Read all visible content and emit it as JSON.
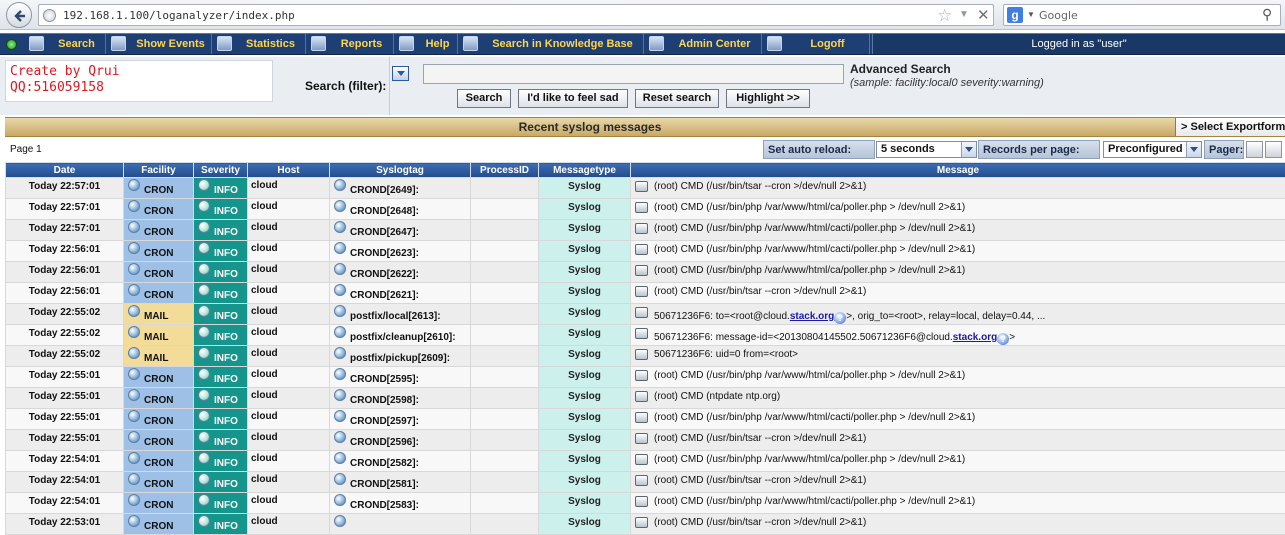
{
  "browser": {
    "url": "192.168.1.100/loganalyzer/index.php",
    "search_placeholder": "Google"
  },
  "menu": {
    "items": [
      {
        "label": "Search",
        "icon": "magnifier-icon"
      },
      {
        "label": "Show Events",
        "icon": "home-icon"
      },
      {
        "label": "Statistics",
        "icon": "chart-icon"
      },
      {
        "label": "Reports",
        "icon": "reports-icon"
      },
      {
        "label": "Help",
        "icon": "help-icon"
      },
      {
        "label": "Search in Knowledge Base",
        "icon": "knowledgebase-icon"
      },
      {
        "label": "Admin Center",
        "icon": "star-icon"
      },
      {
        "label": "Logoff",
        "icon": "logoff-icon"
      }
    ],
    "logged_in": "Logged in as \"user\""
  },
  "credit": {
    "line1": "Create by Qrui",
    "line2": "QQ:516059158"
  },
  "search": {
    "label": "Search (filter):",
    "value": "",
    "buttons": [
      "Search",
      "I'd like to feel sad",
      "Reset search",
      "Highlight >>"
    ],
    "advanced_title": "Advanced Search",
    "advanced_sample": "(sample: facility:local0 severity:warning)"
  },
  "table": {
    "title": "Recent syslog messages",
    "export_label": "> Select Exportformat",
    "page_label": "Page 1",
    "auto_reload_label": "Set auto reload:",
    "auto_reload_value": "5 seconds",
    "records_label": "Records per page:",
    "records_value": "Preconfigured (",
    "pager_label": "Pager:",
    "columns": [
      "Date",
      "Facility",
      "Severity",
      "Host",
      "Syslogtag",
      "ProcessID",
      "Messagetype",
      "Message"
    ],
    "rows": [
      {
        "date": "Today 22:57:01",
        "facility": "CRON",
        "severity": "INFO",
        "host": "cloud",
        "tag": "CROND[2649]:",
        "pid": "",
        "type": "Syslog",
        "message": "(root) CMD (/usr/bin/tsar --cron >/dev/null 2>&1)"
      },
      {
        "date": "Today 22:57:01",
        "facility": "CRON",
        "severity": "INFO",
        "host": "cloud",
        "tag": "CROND[2648]:",
        "pid": "",
        "type": "Syslog",
        "message": "(root) CMD (/usr/bin/php /var/www/html/ca/poller.php > /dev/null 2>&1)"
      },
      {
        "date": "Today 22:57:01",
        "facility": "CRON",
        "severity": "INFO",
        "host": "cloud",
        "tag": "CROND[2647]:",
        "pid": "",
        "type": "Syslog",
        "message": "(root) CMD (/usr/bin/php /var/www/html/cacti/poller.php > /dev/null 2>&1)"
      },
      {
        "date": "Today 22:56:01",
        "facility": "CRON",
        "severity": "INFO",
        "host": "cloud",
        "tag": "CROND[2623]:",
        "pid": "",
        "type": "Syslog",
        "message": "(root) CMD (/usr/bin/php /var/www/html/cacti/poller.php > /dev/null 2>&1)"
      },
      {
        "date": "Today 22:56:01",
        "facility": "CRON",
        "severity": "INFO",
        "host": "cloud",
        "tag": "CROND[2622]:",
        "pid": "",
        "type": "Syslog",
        "message": "(root) CMD (/usr/bin/php /var/www/html/ca/poller.php > /dev/null 2>&1)"
      },
      {
        "date": "Today 22:56:01",
        "facility": "CRON",
        "severity": "INFO",
        "host": "cloud",
        "tag": "CROND[2621]:",
        "pid": "",
        "type": "Syslog",
        "message": "(root) CMD (/usr/bin/tsar --cron >/dev/null 2>&1)"
      },
      {
        "date": "Today 22:55:02",
        "facility": "MAIL",
        "severity": "INFO",
        "host": "cloud",
        "tag": "postfix/local[2613]:",
        "pid": "",
        "type": "Syslog",
        "message_pre": "50671236F6: to=<root@cloud.",
        "message_link": "stack.org",
        "message_post": ">, orig_to=<root>, relay=local, delay=0.44, ..."
      },
      {
        "date": "Today 22:55:02",
        "facility": "MAIL",
        "severity": "INFO",
        "host": "cloud",
        "tag": "postfix/cleanup[2610]:",
        "pid": "",
        "type": "Syslog",
        "message_pre": "50671236F6: message-id=<20130804145502.50671236F6@cloud.",
        "message_link": "stack.org",
        "message_post": ">"
      },
      {
        "date": "Today 22:55:02",
        "facility": "MAIL",
        "severity": "INFO",
        "host": "cloud",
        "tag": "postfix/pickup[2609]:",
        "pid": "",
        "type": "Syslog",
        "message": "50671236F6: uid=0 from=<root>"
      },
      {
        "date": "Today 22:55:01",
        "facility": "CRON",
        "severity": "INFO",
        "host": "cloud",
        "tag": "CROND[2595]:",
        "pid": "",
        "type": "Syslog",
        "message": "(root) CMD (/usr/bin/php /var/www/html/ca/poller.php > /dev/null 2>&1)"
      },
      {
        "date": "Today 22:55:01",
        "facility": "CRON",
        "severity": "INFO",
        "host": "cloud",
        "tag": "CROND[2598]:",
        "pid": "",
        "type": "Syslog",
        "message": "(root) CMD (ntpdate ntp.org)"
      },
      {
        "date": "Today 22:55:01",
        "facility": "CRON",
        "severity": "INFO",
        "host": "cloud",
        "tag": "CROND[2597]:",
        "pid": "",
        "type": "Syslog",
        "message": "(root) CMD (/usr/bin/php /var/www/html/cacti/poller.php > /dev/null 2>&1)"
      },
      {
        "date": "Today 22:55:01",
        "facility": "CRON",
        "severity": "INFO",
        "host": "cloud",
        "tag": "CROND[2596]:",
        "pid": "",
        "type": "Syslog",
        "message": "(root) CMD (/usr/bin/tsar --cron >/dev/null 2>&1)"
      },
      {
        "date": "Today 22:54:01",
        "facility": "CRON",
        "severity": "INFO",
        "host": "cloud",
        "tag": "CROND[2582]:",
        "pid": "",
        "type": "Syslog",
        "message": "(root) CMD (/usr/bin/php /var/www/html/ca/poller.php > /dev/null 2>&1)"
      },
      {
        "date": "Today 22:54:01",
        "facility": "CRON",
        "severity": "INFO",
        "host": "cloud",
        "tag": "CROND[2581]:",
        "pid": "",
        "type": "Syslog",
        "message": "(root) CMD (/usr/bin/tsar --cron >/dev/null 2>&1)"
      },
      {
        "date": "Today 22:54:01",
        "facility": "CRON",
        "severity": "INFO",
        "host": "cloud",
        "tag": "CROND[2583]:",
        "pid": "",
        "type": "Syslog",
        "message": "(root) CMD (/usr/bin/php /var/www/html/cacti/poller.php > /dev/null 2>&1)"
      },
      {
        "date": "Today 22:53:01",
        "facility": "CRON",
        "severity": "INFO",
        "host": "cloud",
        "tag": "",
        "pid": "",
        "type": "Syslog",
        "message": "(root) CMD (/usr/bin/tsar --cron >/dev/null 2>&1)"
      }
    ]
  }
}
